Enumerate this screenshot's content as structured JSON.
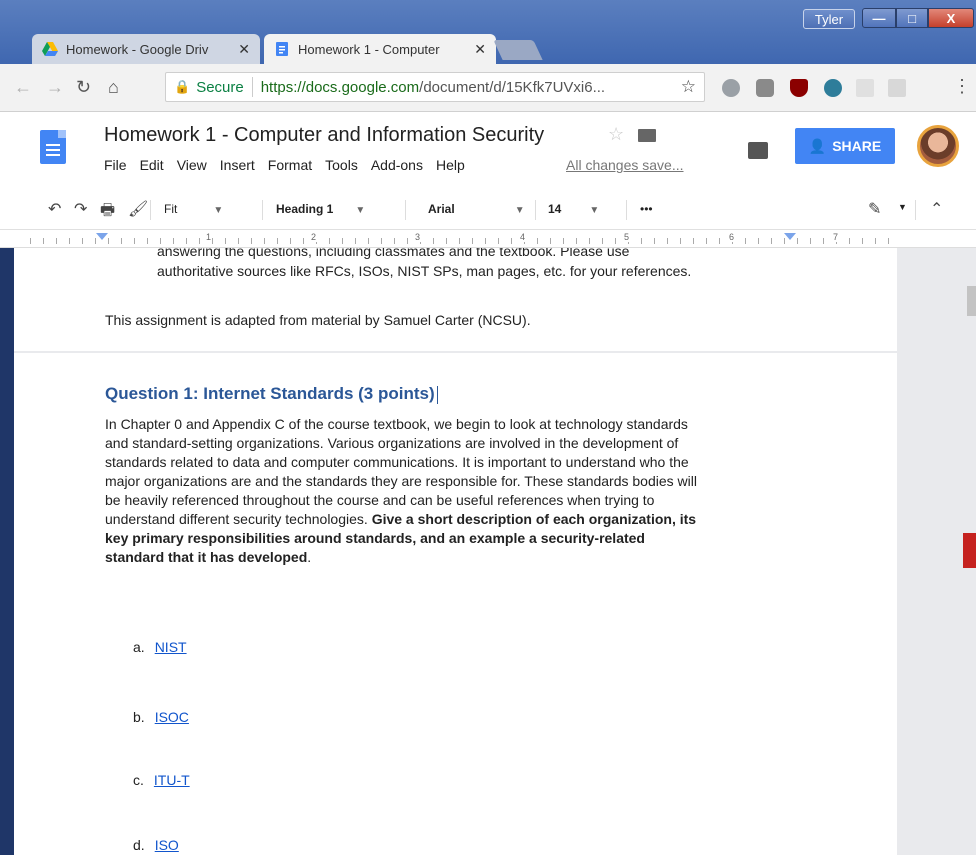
{
  "window": {
    "user": "Tyler",
    "minimize": "—",
    "maximize": "□",
    "close": "X"
  },
  "tabs": [
    {
      "title": "Homework - Google Driv",
      "icon": "google-drive-icon",
      "close": "✕"
    },
    {
      "title": "Homework 1 - Computer",
      "icon": "google-docs-icon",
      "close": "✕"
    }
  ],
  "omnibar": {
    "secure_label": "Secure",
    "url_host": "https://docs.google.com",
    "url_path": "/document/d/15Kfk7UVxi6..."
  },
  "doc": {
    "title": "Homework 1 - Computer and Information Security",
    "menu": [
      "File",
      "Edit",
      "View",
      "Insert",
      "Format",
      "Tools",
      "Add-ons",
      "Help"
    ],
    "save_status": "All changes save...",
    "share_label": "SHARE"
  },
  "toolbar": {
    "zoom": "Fit",
    "style": "Heading 1",
    "font": "Arial",
    "size": "14",
    "more": "•••"
  },
  "ruler": [
    "1",
    "2",
    "3",
    "4",
    "5",
    "6",
    "7"
  ],
  "content": {
    "p1_line1": "answering the questions, including classmates and the textbook.  Please use",
    "p1_line2": "authoritative sources like RFCs, ISOs, NIST SPs, man pages, etc. for your references.",
    "p2": "This assignment is adapted from material by Samuel Carter (NCSU).",
    "heading": "Question 1: Internet Standards (3 points)",
    "body_lines": [
      "In Chapter 0 and Appendix C of the course textbook, we begin to look at technology standards",
      "and standard-setting organizations.  Various organizations are involved in the development of",
      "standards related to data and computer communications.  It is important to understand who the",
      "major organizations are and the standards they are responsible for.  These standards bodies will",
      "be heavily referenced throughout the course and can be useful references when trying to"
    ],
    "body_line6_normal": "understand different security technologies.  ",
    "body_line6_bold": "Give a short description of each organization, its",
    "bold_line7": "key primary responsibilities around standards, and an example a security-related",
    "bold_line8": "standard that it has developed",
    "bold_line8_tail": ".",
    "list": [
      {
        "marker": "a.",
        "label": "NIST"
      },
      {
        "marker": "b.",
        "label": "ISOC"
      },
      {
        "marker": "c.",
        "label": "ITU-T"
      },
      {
        "marker": "d.",
        "label": "ISO"
      }
    ]
  }
}
